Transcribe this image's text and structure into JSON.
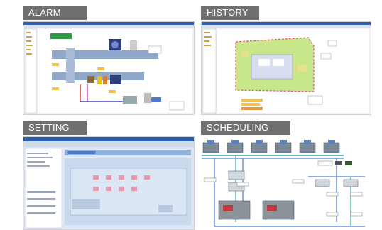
{
  "panels": {
    "alarm": {
      "label": "ALARM"
    },
    "history": {
      "label": "HISTORY"
    },
    "setting": {
      "label": "SETTING"
    },
    "scheduling": {
      "label": "SCHEDULING"
    }
  },
  "colors": {
    "label_bg": "#6f6f6f",
    "label_text": "#ffffff",
    "window_title_bar": "#2c5fa8",
    "duct": "#8fa7c9",
    "pipe_teal": "#3aa6a0",
    "floor_plan_green": "#c8e68a",
    "floor_plan_outline": "#e0527a"
  }
}
